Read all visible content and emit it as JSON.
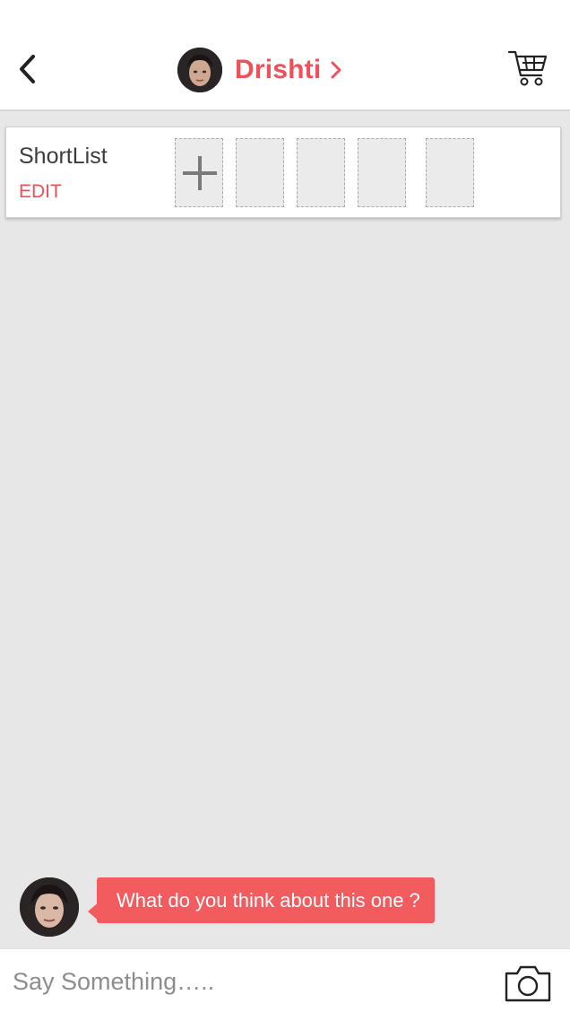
{
  "header": {
    "contact_name": "Drishti",
    "icons": {
      "back": "chevron-left-icon",
      "forward": "chevron-right-icon",
      "cart": "cart-icon"
    }
  },
  "shortlist": {
    "title": "ShortList",
    "edit_label": "EDIT",
    "add_icon": "plus-icon",
    "empty_slots": 4
  },
  "chat": {
    "messages": [
      {
        "from": "Drishti",
        "text": "What do you think about this one ?"
      }
    ]
  },
  "composer": {
    "placeholder": "Say Something…..",
    "camera_icon": "camera-icon"
  },
  "colors": {
    "accent": "#f0505a",
    "bubble": "#f25c5f",
    "background": "#e7e7e7"
  }
}
